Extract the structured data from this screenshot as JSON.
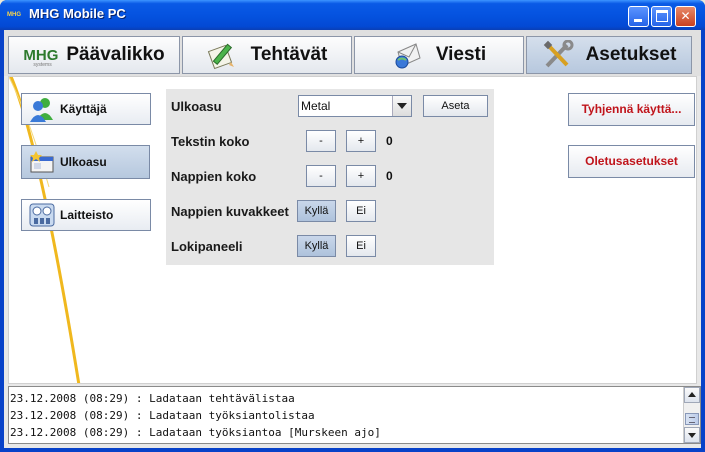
{
  "window": {
    "title": "MHG Mobile PC",
    "title_logo": "MHG"
  },
  "tabs": [
    {
      "label": "Päävalikko",
      "icon": "mhg-logo",
      "logo_text": "MHG",
      "logo_g": "",
      "logo_sub": "systems"
    },
    {
      "label": "Tehtävät",
      "icon": "pencil-clipboard-icon"
    },
    {
      "label": "Viesti",
      "icon": "envelope-globe-icon"
    },
    {
      "label": "Asetukset",
      "icon": "tools-icon",
      "active": true
    }
  ],
  "sidebar": [
    {
      "label": "Käyttäjä",
      "icon": "users-icon"
    },
    {
      "label": "Ulkoasu",
      "icon": "appearance-icon",
      "active": true
    },
    {
      "label": "Laitteisto",
      "icon": "hardware-icon"
    }
  ],
  "settings": {
    "appearance_label": "Ulkoasu",
    "appearance_value": "Metal",
    "apply_label": "Aseta",
    "text_size_label": "Tekstin koko",
    "text_size_value": "0",
    "button_size_label": "Nappien koko",
    "button_size_value": "0",
    "minus": "-",
    "plus": "+",
    "button_icons_label": "Nappien kuvakkeet",
    "log_panel_label": "Lokipaneeli",
    "yes": "Kyllä",
    "no": "Ei"
  },
  "actions": {
    "clear_users_label": "Tyhjennä käyttä...",
    "defaults_label": "Oletusasetukset"
  },
  "log": {
    "lines": [
      "23.12.2008 (08:29) : Ladataan tehtävälistaa",
      "23.12.2008 (08:29) : Ladataan työksiantolistaa",
      "23.12.2008 (08:29) : Ladataan työksiantoa [Murskeen ajo]"
    ]
  },
  "colors": {
    "accent_red": "#c0141b",
    "diagonal_line": "#f0b81e",
    "titlebar": "#0553e0"
  }
}
